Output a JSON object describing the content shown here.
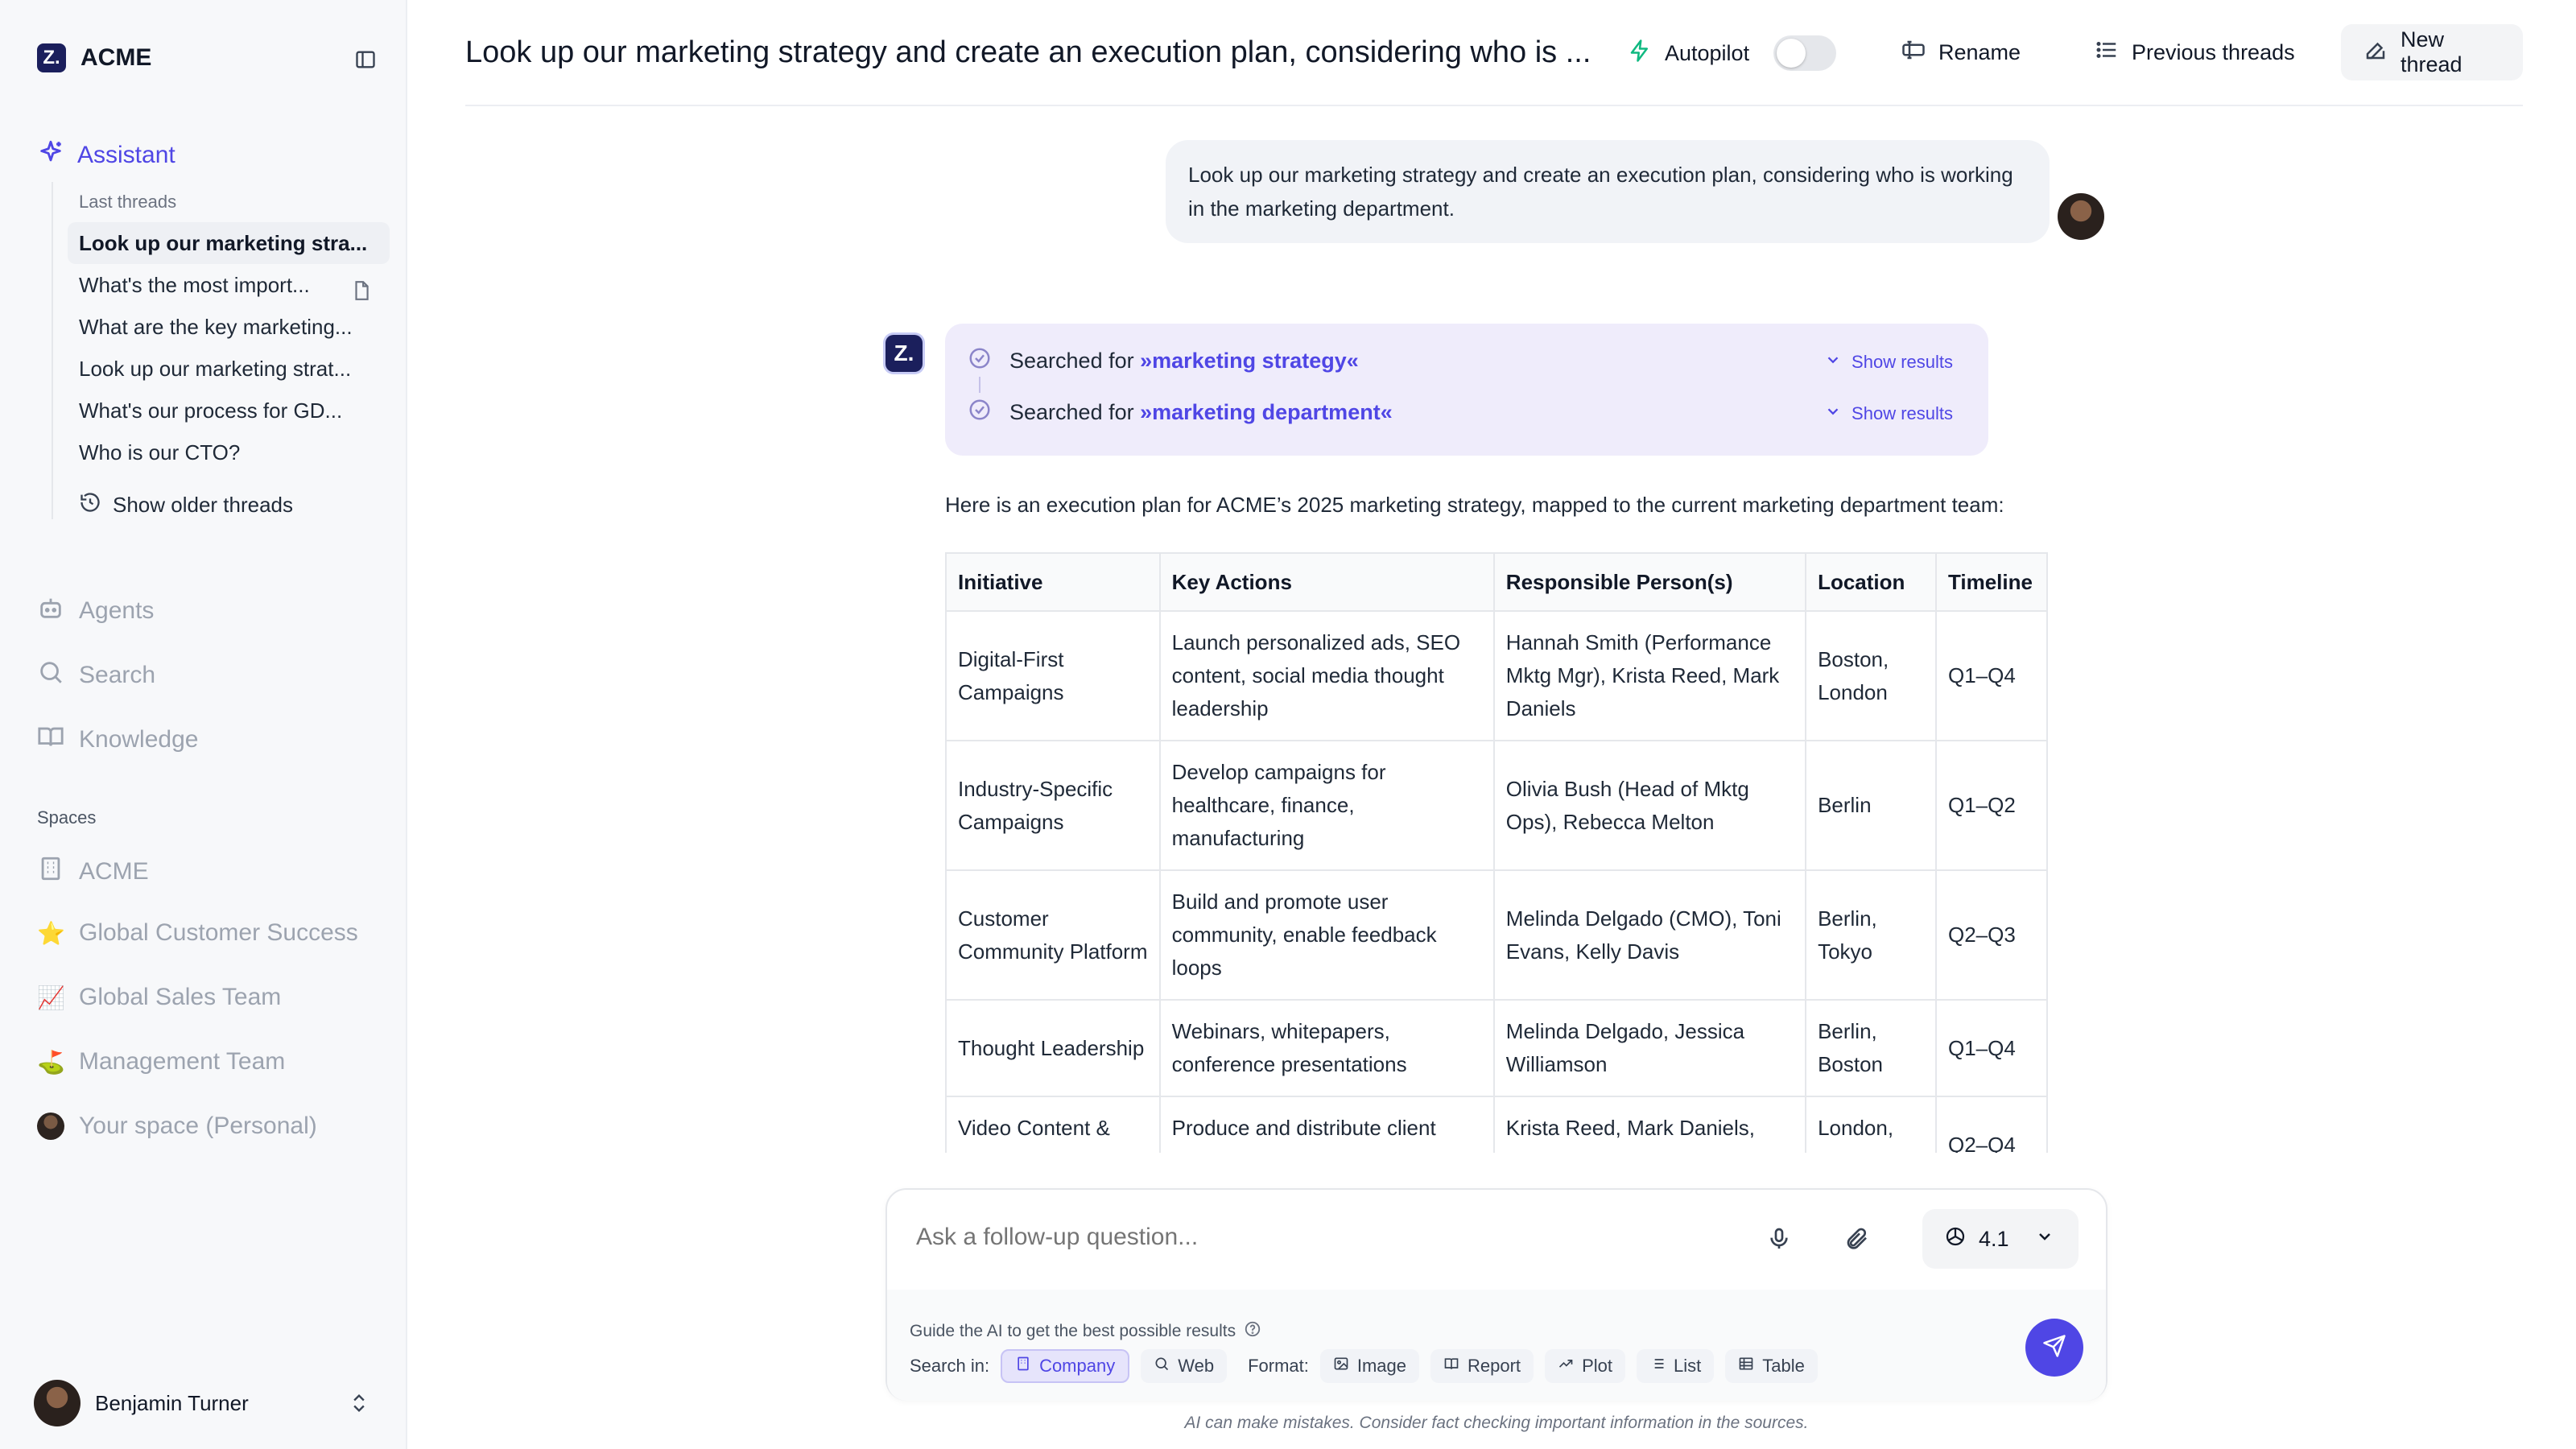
{
  "sidebar": {
    "brand": "ACME",
    "brand_logo": "Z.",
    "assistant": "Assistant",
    "last_threads_title": "Last threads",
    "threads": [
      {
        "label": "Look up our marketing stra..."
      },
      {
        "label": "What's the most import..."
      },
      {
        "label": "What are the key marketing..."
      },
      {
        "label": "Look up our marketing strat..."
      },
      {
        "label": "What's our process for GD..."
      },
      {
        "label": "Who is our CTO?"
      }
    ],
    "show_older": "Show older threads",
    "nav": {
      "agents": "Agents",
      "search": "Search",
      "knowledge": "Knowledge"
    },
    "spaces_title": "Spaces",
    "spaces": [
      {
        "label": "ACME",
        "icon": "building-icon"
      },
      {
        "label": "Global Customer Success",
        "icon": "⭐"
      },
      {
        "label": "Global Sales Team",
        "icon": "📈"
      },
      {
        "label": "Management Team",
        "icon": "⛳"
      },
      {
        "label": "Your space (Personal)",
        "icon": "avatar"
      }
    ],
    "user_name": "Benjamin Turner"
  },
  "header": {
    "title": "Look up our marketing strategy and create an execution plan, considering who is ...",
    "autopilot": "Autopilot",
    "autopilot_on": false,
    "rename": "Rename",
    "previous_threads": "Previous threads",
    "new_thread": "New thread"
  },
  "conversation": {
    "user_message": "Look up our marketing strategy and create an execution plan, considering who is working in the marketing department.",
    "searches": [
      {
        "prefix": "Searched for",
        "query": "»marketing strategy«",
        "action": "Show results"
      },
      {
        "prefix": "Searched for",
        "query": "»marketing department«",
        "action": "Show results"
      }
    ],
    "intro": "Here is an execution plan for ACME’s 2025 marketing strategy, mapped to the current marketing department team:",
    "table": {
      "headers": [
        "Initiative",
        "Key Actions",
        "Responsible Person(s)",
        "Location",
        "Timeline"
      ],
      "rows": [
        [
          "Digital-First Campaigns",
          "Launch personalized ads, SEO content, social media thought leadership",
          "Hannah Smith (Performance Mktg Mgr), Krista Reed, Mark Daniels",
          "Boston, London",
          "Q1–Q4"
        ],
        [
          "Industry-Specific Campaigns",
          "Develop campaigns for healthcare, finance, manufacturing",
          "Olivia Bush (Head of Mktg Ops), Rebecca Melton",
          "Berlin",
          "Q1–Q2"
        ],
        [
          "Customer Community Platform",
          "Build and promote user community, enable feedback loops",
          "Melinda Delgado (CMO), Toni Evans, Kelly Davis",
          "Berlin, Tokyo",
          "Q2–Q3"
        ],
        [
          "Thought Leadership",
          "Webinars, whitepapers, conference presentations",
          "Melinda Delgado, Jessica Williamson",
          "Berlin, Boston",
          "Q1–Q4"
        ],
        [
          "Video Content & Case Studies",
          "Produce and distribute client success stories",
          "Krista Reed, Mark Daniels, Rebecca Melton",
          "London, Berlin",
          "Q2–Q4"
        ]
      ]
    }
  },
  "composer": {
    "placeholder": "Ask a follow-up question...",
    "model": "4.1",
    "guide": "Guide the AI to get the best possible results",
    "search_in_label": "Search in:",
    "search_in": [
      {
        "label": "Company",
        "selected": true
      },
      {
        "label": "Web",
        "selected": false
      }
    ],
    "format_label": "Format:",
    "formats": [
      {
        "label": "Image"
      },
      {
        "label": "Report"
      },
      {
        "label": "Plot"
      },
      {
        "label": "List"
      },
      {
        "label": "Table"
      }
    ],
    "disclaimer": "AI can make mistakes. Consider fact checking important information in the sources."
  },
  "colors": {
    "accent": "#4f46e5",
    "brand_dark": "#1b1f5c",
    "search_bg": "#efecfb"
  }
}
